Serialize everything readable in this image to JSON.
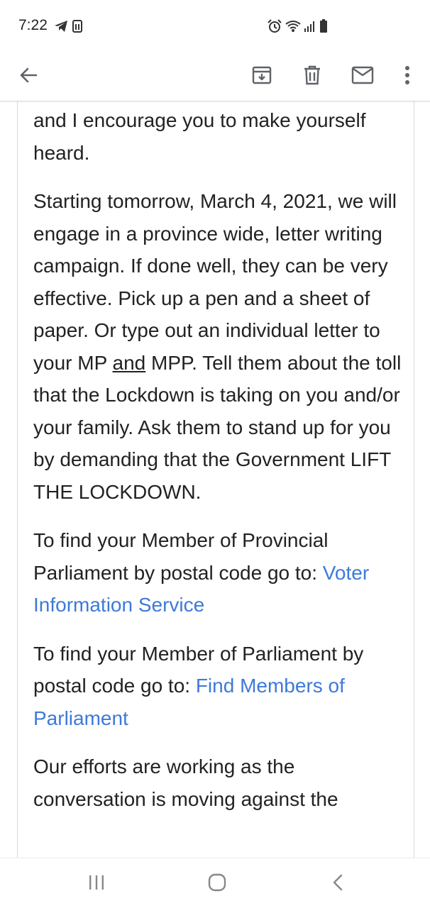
{
  "status_bar": {
    "time": "7:22",
    "left_icons": [
      "telegram-icon",
      "sim-icon"
    ],
    "right_icons": [
      "alarm-icon",
      "wifi-icon",
      "signal-icon",
      "battery-icon"
    ]
  },
  "toolbar": {
    "back_icon": "arrow-back-icon",
    "archive_icon": "archive-icon",
    "delete_icon": "trash-icon",
    "mark_unread_icon": "mail-icon",
    "more_icon": "more-vert-icon"
  },
  "email": {
    "p1": "and I encourage you to make yourself heard.",
    "p2_before": "Starting tomorrow, March 4, 2021, we will engage in a province wide, letter writing campaign. If done well, they can be very effective.  Pick up a pen and a sheet of paper.  Or type out an individual letter to your MP ",
    "p2_underlined": "and",
    "p2_after": " MPP. Tell them about the toll that the Lockdown is taking on you and/or your family.  Ask them to stand up for you by demanding that the Government LIFT THE LOCKDOWN.",
    "p3_text": "To find your Member of Provincial Parliament by postal code go to: ",
    "p3_link": "Voter Information Service",
    "p4_text": "To find your Member of Parliament by postal code go to: ",
    "p4_link": "Find Members of Parliament",
    "p5": "Our efforts are working as the conversation is moving against the"
  },
  "colors": {
    "text": "#222222",
    "link": "#3d7ad8",
    "icon": "#5f6368"
  },
  "nav_bar": {
    "recents_icon": "recents-icon",
    "home_icon": "home-icon",
    "back_icon": "nav-back-icon"
  }
}
